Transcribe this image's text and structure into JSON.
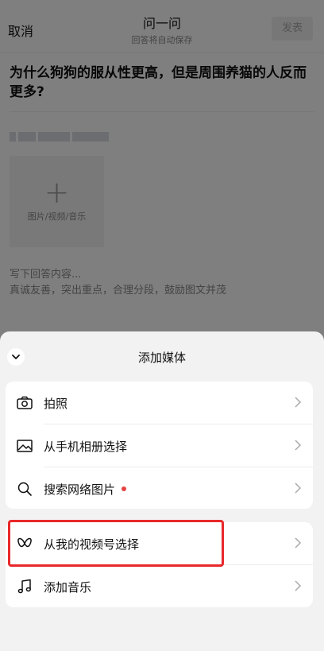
{
  "header": {
    "cancel_label": "取消",
    "title": "问一问",
    "subtitle": "回答将自动保存",
    "publish_label": "发表"
  },
  "question": "为什么狗狗的服从性更高，但是周围养猫的人反而更多?",
  "editor": {
    "media_hint": "图片/视频/音乐",
    "placeholder_line1": "写下回答内容...",
    "placeholder_line2": "真诚友善，突出重点，合理分段，鼓励图文并茂"
  },
  "sheet": {
    "title": "添加媒体",
    "items": [
      {
        "label": "拍照",
        "icon": "camera-icon"
      },
      {
        "label": "从手机相册选择",
        "icon": "image-icon"
      },
      {
        "label": "搜索网络图片",
        "icon": "search-icon",
        "badge": "red-dot"
      },
      {
        "label": "从我的视频号选择",
        "icon": "channels-icon"
      },
      {
        "label": "添加音乐",
        "icon": "music-note-icon"
      }
    ]
  },
  "colors": {
    "highlight": "#e8282a",
    "badge": "#e64340",
    "sheet_bg": "#f2f2f2"
  }
}
